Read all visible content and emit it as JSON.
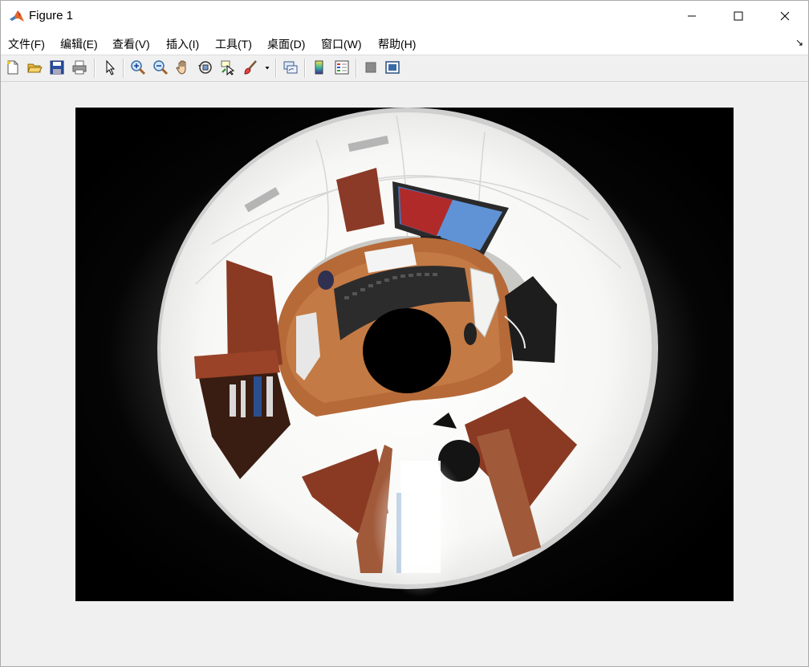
{
  "window": {
    "title": "Figure 1"
  },
  "menu": {
    "items": [
      {
        "label": "文件(F)"
      },
      {
        "label": "编辑(E)"
      },
      {
        "label": "查看(V)"
      },
      {
        "label": "插入(I)"
      },
      {
        "label": "工具(T)"
      },
      {
        "label": "桌面(D)"
      },
      {
        "label": "窗口(W)"
      },
      {
        "label": "帮助(H)"
      }
    ]
  },
  "toolbar": {
    "buttons": [
      {
        "icon": "new-figure-icon"
      },
      {
        "icon": "open-file-icon"
      },
      {
        "icon": "save-icon"
      },
      {
        "icon": "print-icon"
      },
      {
        "icon": "edit-plot-arrow-icon"
      },
      {
        "icon": "zoom-in-icon"
      },
      {
        "icon": "zoom-out-icon"
      },
      {
        "icon": "pan-hand-icon"
      },
      {
        "icon": "rotate-3d-icon"
      },
      {
        "icon": "data-cursor-icon"
      },
      {
        "icon": "brush-icon"
      },
      {
        "icon": "link-plot-icon"
      },
      {
        "icon": "insert-colorbar-icon"
      },
      {
        "icon": "insert-legend-icon"
      },
      {
        "icon": "hide-plot-tools-icon"
      },
      {
        "icon": "show-plot-tools-icon"
      }
    ]
  },
  "figure": {
    "content": "fisheye office photo"
  },
  "colors": {
    "titlebar_bg": "#ffffff",
    "window_bg": "#f0f0f0",
    "desk": "#b86a3a",
    "cabinet": "#8a3a22"
  }
}
